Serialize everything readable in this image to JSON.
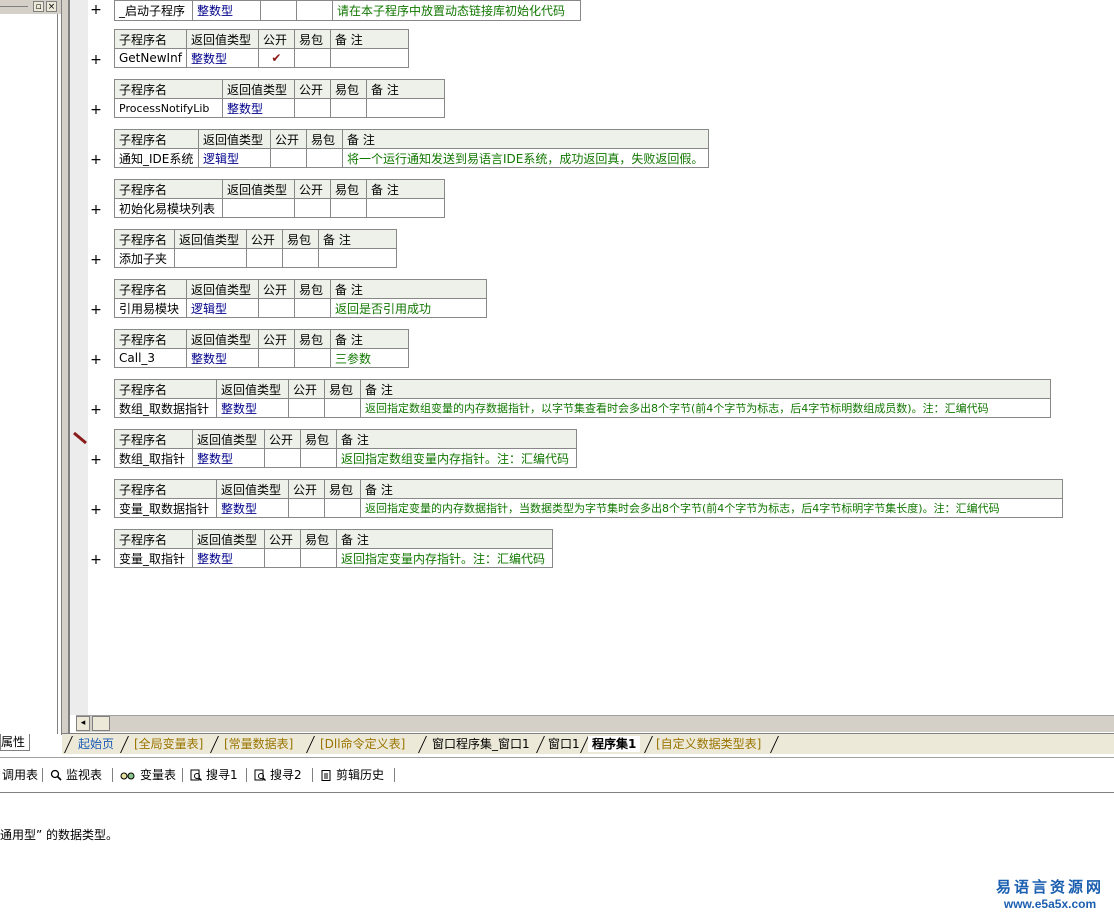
{
  "left_panel": {
    "min_btn": "▫",
    "close_btn": "×",
    "props_tab": "属性"
  },
  "table_headers": {
    "name": "子程序名",
    "ret": "返回值类型",
    "pub": "公开",
    "easy": "易包",
    "note": "备 注"
  },
  "subroutines": [
    {
      "name": "_启动子程序",
      "ret": "整数型",
      "pub": "",
      "easy": "",
      "note": "请在本子程序中放置动态链接库初始化代码"
    },
    {
      "name": "GetNewInf",
      "ret": "整数型",
      "pub": "✔",
      "easy": "",
      "note": ""
    },
    {
      "name": "ProcessNotifyLib",
      "ret": "整数型",
      "pub": "",
      "easy": "",
      "note": ""
    },
    {
      "name": "通知_IDE系统",
      "ret": "逻辑型",
      "pub": "",
      "easy": "",
      "note": "将一个运行通知发送到易语言IDE系统，成功返回真，失败返回假。"
    },
    {
      "name": "初始化易模块列表",
      "ret": "",
      "pub": "",
      "easy": "",
      "note": ""
    },
    {
      "name": "添加子夹",
      "ret": "",
      "pub": "",
      "easy": "",
      "note": ""
    },
    {
      "name": "引用易模块",
      "ret": "逻辑型",
      "pub": "",
      "easy": "",
      "note": "返回是否引用成功"
    },
    {
      "name": "Call_3",
      "ret": "整数型",
      "pub": "",
      "easy": "",
      "note": "三参数"
    },
    {
      "name": "数组_取数据指针",
      "ret": "整数型",
      "pub": "",
      "easy": "",
      "note": "返回指定数组变量的内存数据指针，以字节集查看时会多出8个字节(前4个字节为标志，后4字节标明数组成员数)。注：汇编代码"
    },
    {
      "name": "数组_取指针",
      "ret": "整数型",
      "pub": "",
      "easy": "",
      "note": "返回指定数组变量内存指针。注：汇编代码"
    },
    {
      "name": "变量_取数据指针",
      "ret": "整数型",
      "pub": "",
      "easy": "",
      "note": "返回指定变量的内存数据指针，当数据类型为字节集时会多出8个字节(前4个字节为标志，后4字节标明字节集长度)。注：汇编代码"
    },
    {
      "name": "变量_取指针",
      "ret": "整数型",
      "pub": "",
      "easy": "",
      "note": "返回指定变量内存指针。注：汇编代码"
    }
  ],
  "expand_symbol": "+",
  "scroll": {
    "left_arrow": "◂"
  },
  "tabs": [
    {
      "label": "起始页",
      "color": "#1a5bb5"
    },
    {
      "label": "[全局变量表]",
      "color": "#9a7400"
    },
    {
      "label": "[常量数据表]",
      "color": "#9a7400"
    },
    {
      "label": "[Dll命令定义表]",
      "color": "#9a7400"
    },
    {
      "label": "窗口程序集_窗口1",
      "color": "#000000"
    },
    {
      "label": "窗口1",
      "color": "#000000"
    },
    {
      "label": "程序集1",
      "color": "#000000"
    },
    {
      "label": "[自定义数据类型表]",
      "color": "#9a7400"
    }
  ],
  "toolbar": {
    "items": [
      {
        "label": "调用表",
        "icon": "none"
      },
      {
        "label": "监视表",
        "icon": "magnifier-icon"
      },
      {
        "label": "变量表",
        "icon": "variables-icon"
      },
      {
        "label": "搜寻1",
        "icon": "search-doc-icon"
      },
      {
        "label": "搜寻2",
        "icon": "search-doc-icon"
      },
      {
        "label": "剪辑历史",
        "icon": "clipboard-icon"
      }
    ]
  },
  "status_text": "通用型” 的数据类型。",
  "watermark": {
    "line1": "易语言资源网",
    "line2": "www.e5a5x.com"
  }
}
